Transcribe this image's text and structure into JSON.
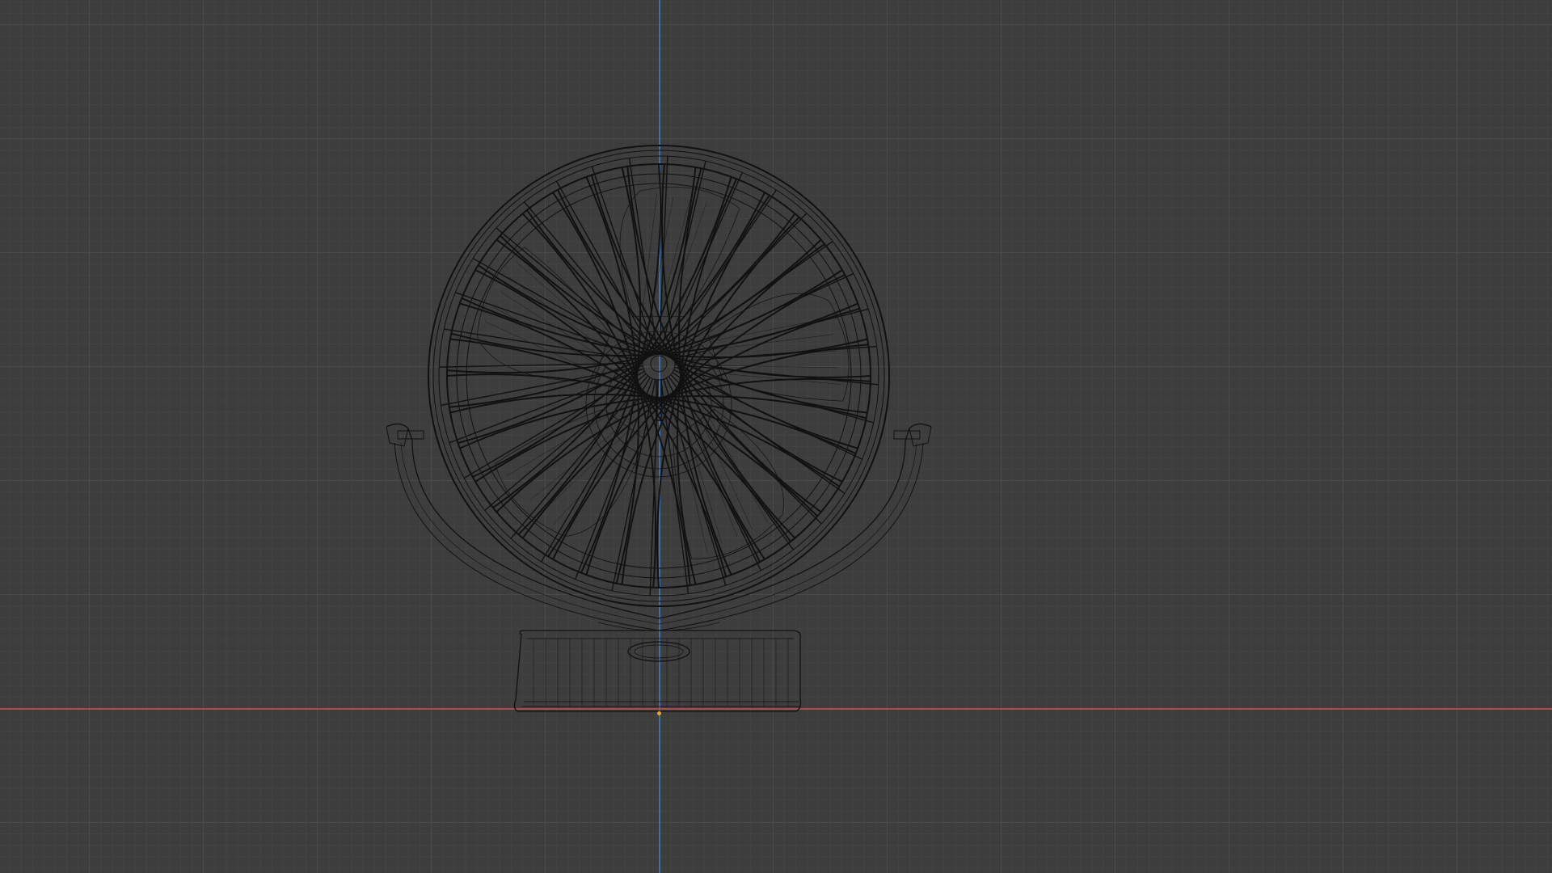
{
  "viewport": {
    "background_color": "#3d3d3d",
    "grid_major_color": "#4a4a4a",
    "grid_minor_color": "#434343",
    "x_axis_color": "#b5474a",
    "z_axis_color": "#3f6fa8",
    "origin_color": "#f0a020",
    "wire_color": "#111111",
    "shading_mode": "wireframe",
    "view": "front-orthographic"
  },
  "model": {
    "object": "desk-fan",
    "grille_ring_count": 6,
    "grille_spoke_count": 36,
    "blade_count": 5
  }
}
